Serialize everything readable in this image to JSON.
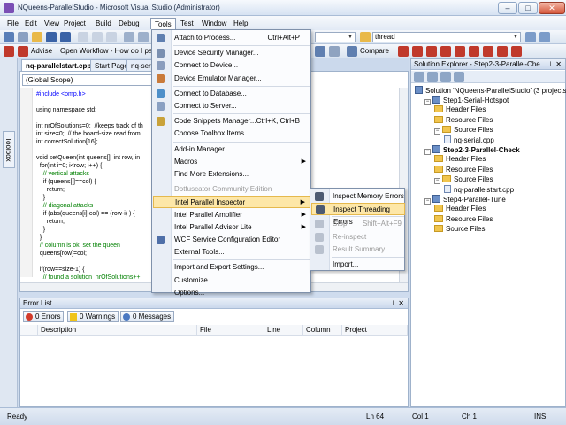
{
  "window": {
    "title": "NQueens-ParallelStudio - Microsoft Visual Studio (Administrator)",
    "minimize": "–",
    "maximize": "□",
    "close": "✕"
  },
  "menubar": [
    "File",
    "Edit",
    "View",
    "Project",
    "Build",
    "Debug",
    "Tools",
    "Test",
    "Window",
    "Help"
  ],
  "toolbar": {
    "advise_label": "Advise",
    "open_workflow_label": "Open Workflow - How do I par",
    "thread_combo": "thread",
    "compare_label": "Compare"
  },
  "toolbox": {
    "label": "Toolbox"
  },
  "doc_tabs": [
    "nq-parallelstart.cpp",
    "Start Page",
    "nq-seri"
  ],
  "editor": {
    "scope": "(Global Scope)",
    "lines": [
      {
        "text": "#include <omp.h>",
        "type": "kw"
      },
      {
        "text": "",
        "type": "plain"
      },
      {
        "text": "using namespace std;",
        "type": "plain"
      },
      {
        "text": "",
        "type": "plain"
      },
      {
        "text": "int nrOfSolutions=0;  //keeps track of th",
        "type": "plain"
      },
      {
        "text": "int size=0;  // the board-size read from",
        "type": "plain"
      },
      {
        "text": "int correctSolution[16];",
        "type": "plain"
      },
      {
        "text": "",
        "type": "plain"
      },
      {
        "text": "void setQueen(int queens[], int row, in",
        "type": "plain"
      },
      {
        "text": "  for(int i=0; i<row; i++) {",
        "type": "plain"
      },
      {
        "text": "    // vertical attacks",
        "type": "cm"
      },
      {
        "text": "    if (queens[i]==col) {",
        "type": "plain"
      },
      {
        "text": "      return;",
        "type": "plain"
      },
      {
        "text": "    }",
        "type": "plain"
      },
      {
        "text": "    // diagonal attacks",
        "type": "cm"
      },
      {
        "text": "    if (abs(queens[i]-col) == (row-i) ) {",
        "type": "plain"
      },
      {
        "text": "      return;",
        "type": "plain"
      },
      {
        "text": "    }",
        "type": "plain"
      },
      {
        "text": "  }",
        "type": "plain"
      },
      {
        "text": "  // column is ok, set the queen",
        "type": "cm"
      },
      {
        "text": "  queens[row]=col;",
        "type": "plain"
      },
      {
        "text": "",
        "type": "plain"
      },
      {
        "text": "  if(row==size-1) {",
        "type": "plain"
      },
      {
        "text": "    // found a solution  nrOfSolutions++",
        "type": "cm"
      }
    ]
  },
  "tools_menu": [
    {
      "label": "Attach to Process...",
      "shortcut": "Ctrl+Alt+P",
      "icon": "attach-icon"
    },
    {
      "sep": true
    },
    {
      "label": "Device Security Manager...",
      "icon": "device-security-icon"
    },
    {
      "label": "Connect to Device...",
      "icon": "connect-device-icon"
    },
    {
      "label": "Device Emulator Manager...",
      "icon": "emulator-icon"
    },
    {
      "sep": true
    },
    {
      "label": "Connect to Database...",
      "icon": "database-icon"
    },
    {
      "label": "Connect to Server...",
      "icon": "server-icon"
    },
    {
      "sep": true
    },
    {
      "label": "Code Snippets Manager...",
      "shortcut": "Ctrl+K, Ctrl+B",
      "icon": "snippets-icon"
    },
    {
      "label": "Choose Toolbox Items..."
    },
    {
      "sep": true
    },
    {
      "label": "Add-in Manager..."
    },
    {
      "label": "Macros",
      "submenu": true
    },
    {
      "label": "Find More Extensions..."
    },
    {
      "sep": true
    },
    {
      "label": "Dotfuscator Community Edition",
      "disabled": true
    },
    {
      "label": "Intel Parallel Inspector",
      "submenu": true,
      "highlight": true
    },
    {
      "label": "Intel Parallel Amplifier",
      "submenu": true
    },
    {
      "label": "Intel Parallel Advisor Lite",
      "submenu": true
    },
    {
      "label": "WCF Service Configuration Editor",
      "icon": "wcf-icon"
    },
    {
      "label": "External Tools..."
    },
    {
      "sep": true
    },
    {
      "label": "Import and Export Settings..."
    },
    {
      "label": "Customize..."
    },
    {
      "label": "Options..."
    }
  ],
  "inspector_submenu": [
    {
      "label": "Inspect Memory Errors",
      "icon": "memory-errors-icon"
    },
    {
      "label": "Inspect Threading Errors",
      "icon": "threading-errors-icon",
      "highlight": true
    },
    {
      "sep": true
    },
    {
      "label": "Stop",
      "shortcut": "Shift+Alt+F9",
      "disabled": true,
      "icon": "stop-icon"
    },
    {
      "label": "Re-inspect",
      "disabled": true,
      "icon": "reinspect-icon"
    },
    {
      "label": "Result Summary",
      "disabled": true,
      "icon": "summary-icon"
    },
    {
      "sep": true
    },
    {
      "label": "Import..."
    }
  ],
  "error_list": {
    "title": "Error List",
    "errors": "0 Errors",
    "warnings": "0 Warnings",
    "messages": "0 Messages",
    "columns": [
      "Description",
      "File",
      "Line",
      "Column",
      "Project"
    ]
  },
  "solution_explorer": {
    "title": "Solution Explorer - Step2-3-Parallel-Che...",
    "pin": "⊥ ✕",
    "items": [
      {
        "label": "Solution 'NQueens-ParallelStudio' (3 projects)",
        "level": 0,
        "kind": "solution"
      },
      {
        "label": "Step1-Serial-Hotspot",
        "level": 1,
        "kind": "project",
        "expander": "−"
      },
      {
        "label": "Header Files",
        "level": 2,
        "kind": "folder"
      },
      {
        "label": "Resource Files",
        "level": 2,
        "kind": "folder"
      },
      {
        "label": "Source Files",
        "level": 2,
        "kind": "folder",
        "expander": "−"
      },
      {
        "label": "nq-serial.cpp",
        "level": 3,
        "kind": "file"
      },
      {
        "label": "Step2-3-Parallel-Check",
        "level": 1,
        "kind": "project",
        "bold": true,
        "expander": "−"
      },
      {
        "label": "Header Files",
        "level": 2,
        "kind": "folder"
      },
      {
        "label": "Resource Files",
        "level": 2,
        "kind": "folder"
      },
      {
        "label": "Source Files",
        "level": 2,
        "kind": "folder",
        "expander": "−"
      },
      {
        "label": "nq-parallelstart.cpp",
        "level": 3,
        "kind": "file"
      },
      {
        "label": "Step4-Parallel-Tune",
        "level": 1,
        "kind": "project",
        "expander": "−"
      },
      {
        "label": "Header Files",
        "level": 2,
        "kind": "folder"
      },
      {
        "label": "Resource Files",
        "level": 2,
        "kind": "folder"
      },
      {
        "label": "Source Files",
        "level": 2,
        "kind": "folder"
      }
    ]
  },
  "status": {
    "ready": "Ready",
    "ln": "Ln 64",
    "col": "Col 1",
    "ch": "Ch 1",
    "ins": "INS"
  }
}
